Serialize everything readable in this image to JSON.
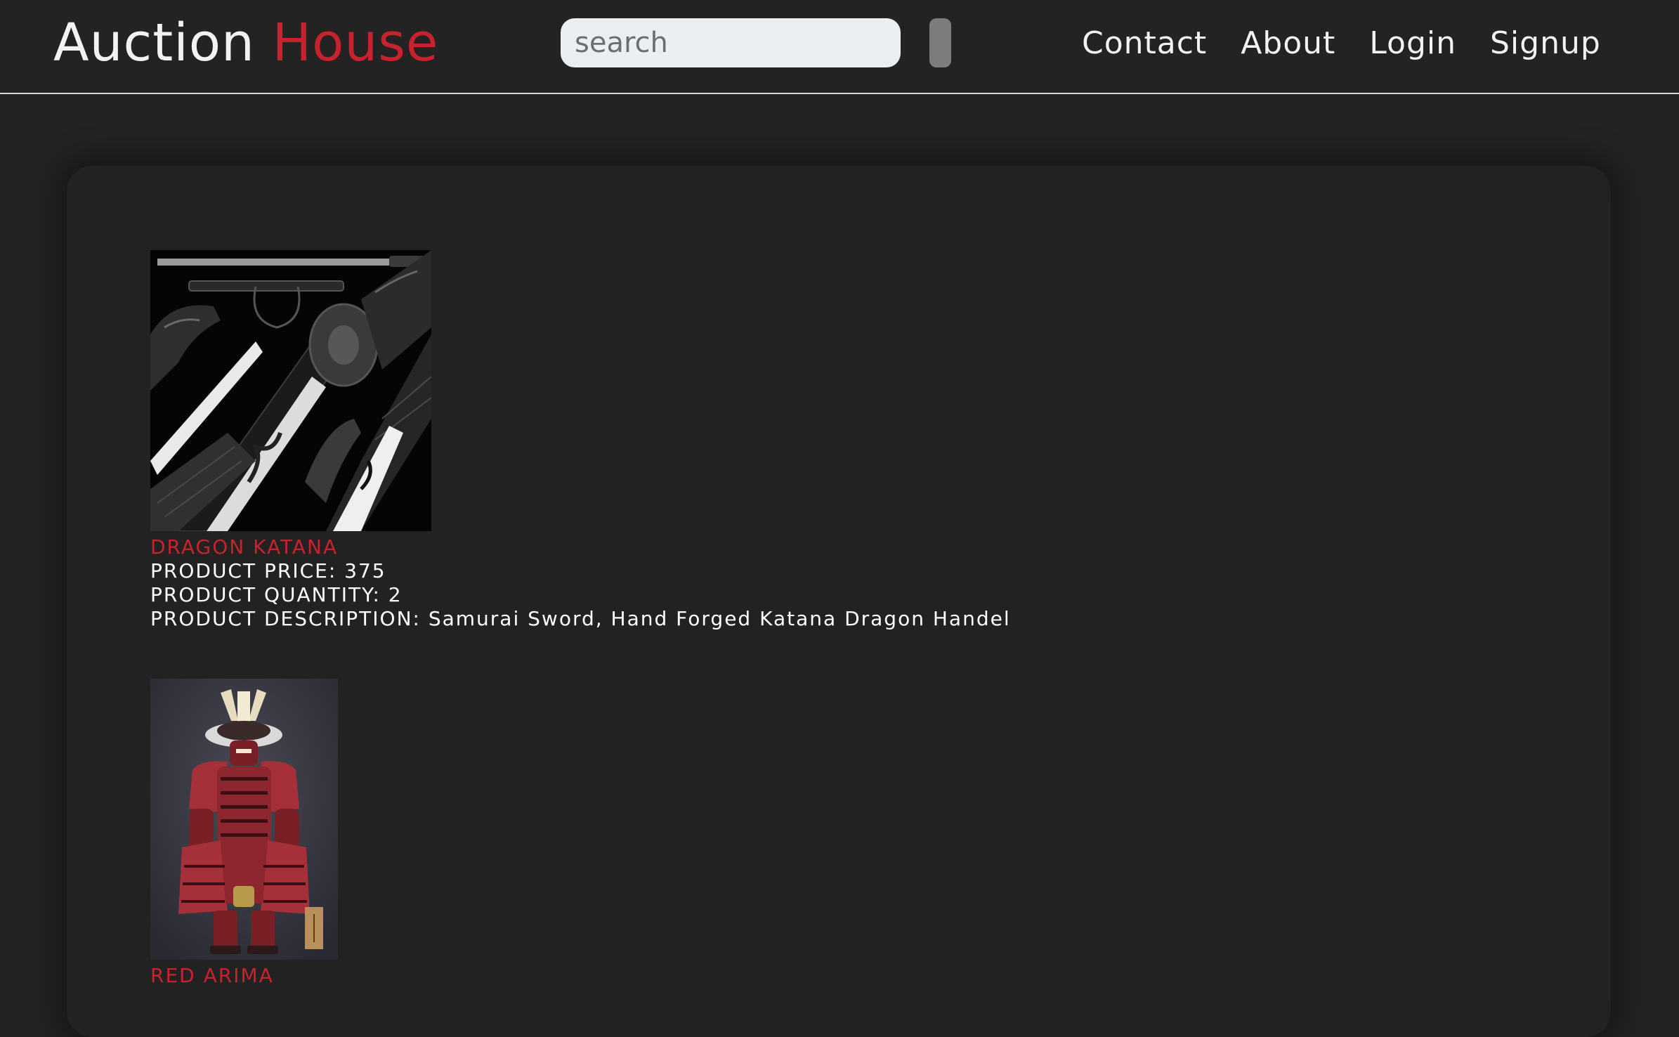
{
  "header": {
    "brand_first": "Auction",
    "brand_second": "House",
    "search_placeholder": "search",
    "nav": [
      "Contact",
      "About",
      "Login",
      "Signup"
    ]
  },
  "colors": {
    "background": "#232323",
    "accent": "#c8222e",
    "search_bg": "#eceff1",
    "search_button": "#7d7d7d"
  },
  "products": [
    {
      "name": "DRAGON KATANA",
      "price_line": "PRODUCT PRICE: 375",
      "quantity_line": "PRODUCT QUANTITY: 2",
      "description_line": "PRODUCT DESCRIPTION: Samurai Sword, Hand Forged Katana Dragon Handel"
    },
    {
      "name": "RED ARIMA"
    }
  ]
}
